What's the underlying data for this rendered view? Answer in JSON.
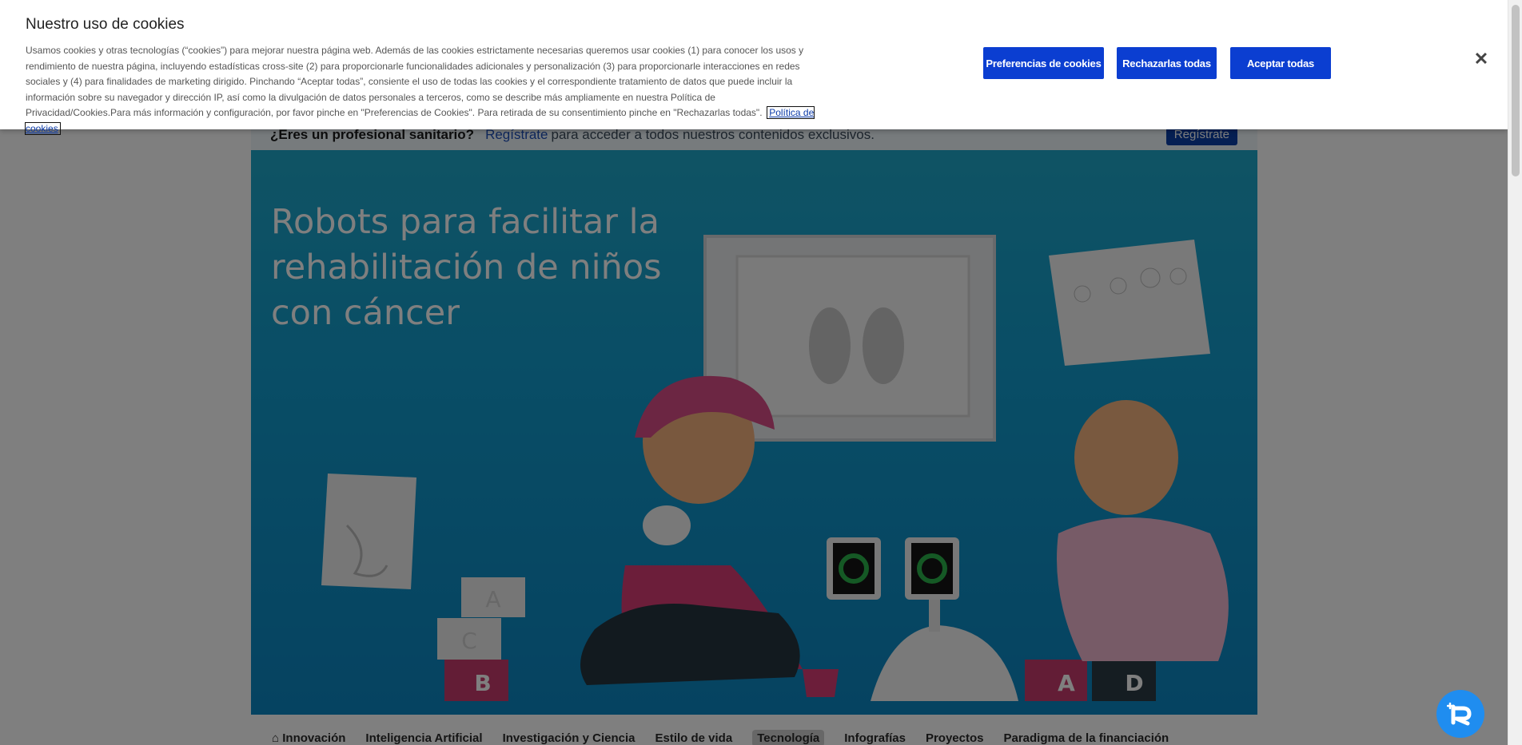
{
  "professional_bar": {
    "question": "¿Eres un profesional sanitario?",
    "link": "Regístrate",
    "rest": "para acceder a todos nuestros contenidos exclusivos.",
    "button": "Regístrate"
  },
  "hero": {
    "title": "Robots para facilitar la rehabilitación de niños con cáncer",
    "block_letters": [
      "A",
      "C",
      "B",
      "A",
      "D"
    ]
  },
  "nav": {
    "items": [
      "Innovación",
      "Inteligencia Artificial",
      "Investigación y Ciencia",
      "Estilo de vida",
      "Tecnología",
      "Infografías",
      "Proyectos",
      "Paradigma de la financiación"
    ],
    "active": "Tecnología"
  },
  "cookie_banner": {
    "title": "Nuestro uso de cookies",
    "text": "Usamos cookies y otras tecnologías (“cookies”) para mejorar nuestra página web. Además de las cookies estrictamente necesarias queremos usar cookies (1) para conocer los usos y rendimiento de nuestra página, incluyendo estadísticas cross-site (2) para proporcionarle funcionalidades adicionales y personalización (3) para proporcionarle interacciones en redes sociales y (4) para finalidades de marketing dirigido. Pinchando “Aceptar todas”, consiente el uso de todas las cookies y el correspondiente tratamiento de datos que puede incluir la información sobre su navegador y dirección IP, así como la divulgación de datos personales a terceros, como se describe más ampliamente en nuestra Política de Privacidad/Cookies.Para más información y configuración, por favor pinche en \"Preferencias de Cookies\". Para retirada de su consentimiento pinche en \"Rechazarlas todas\".",
    "policy_link": "Política de cookies",
    "buttons": {
      "preferences": "Preferencias de cookies",
      "reject": "Rechazarlas todas",
      "accept": "Aceptar todas"
    },
    "close_icon": "close-icon"
  },
  "colors": {
    "primary_button": "#0b3ed1",
    "hero_bg": "#129bcc",
    "fab": "#1f8df0"
  }
}
